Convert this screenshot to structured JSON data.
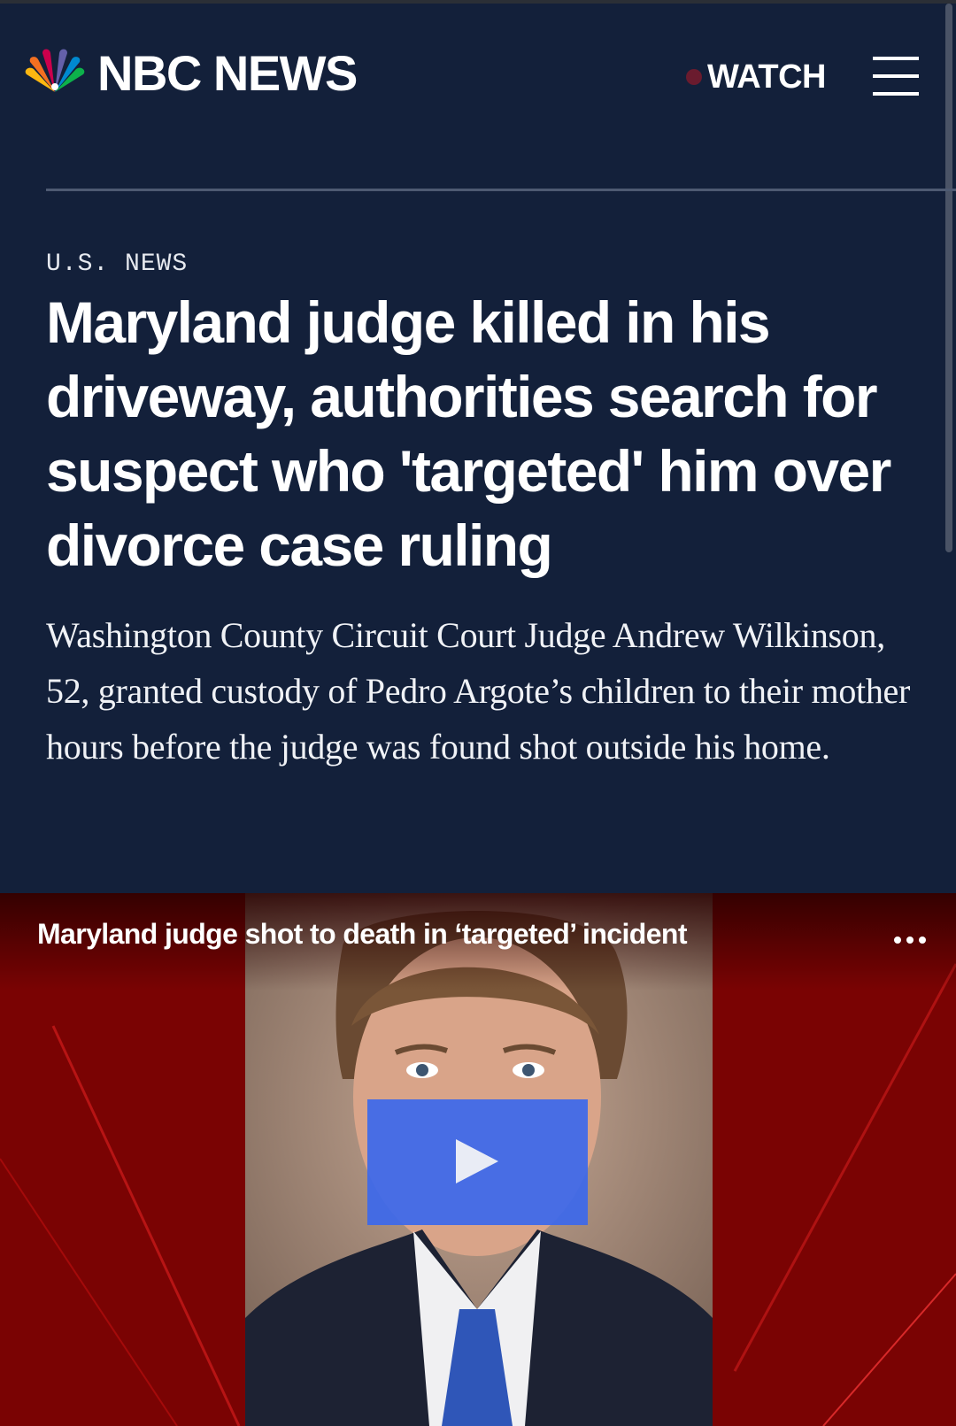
{
  "header": {
    "brand": "NBC NEWS",
    "watch_label": "WATCH"
  },
  "article": {
    "section": "U.S. NEWS",
    "headline": "Maryland judge killed in his driveway, authorities search for suspect who 'targeted' him over divorce case ruling",
    "dek": "Washington County Circuit Court Judge Andrew Wilkinson, 52, granted custody of Pedro Argote’s children to their mother hours before the judge was found shot outside his home."
  },
  "video": {
    "title": "Maryland judge shot to death in ‘targeted’ incident"
  },
  "colors": {
    "page_bg": "#13203a",
    "play_button": "#3c68eb",
    "video_bg": "#8a0505",
    "watch_dot": "#6a1b2e"
  },
  "icons": [
    "nbc-peacock-icon",
    "live-dot-icon",
    "hamburger-menu-icon",
    "more-options-icon",
    "play-icon"
  ]
}
